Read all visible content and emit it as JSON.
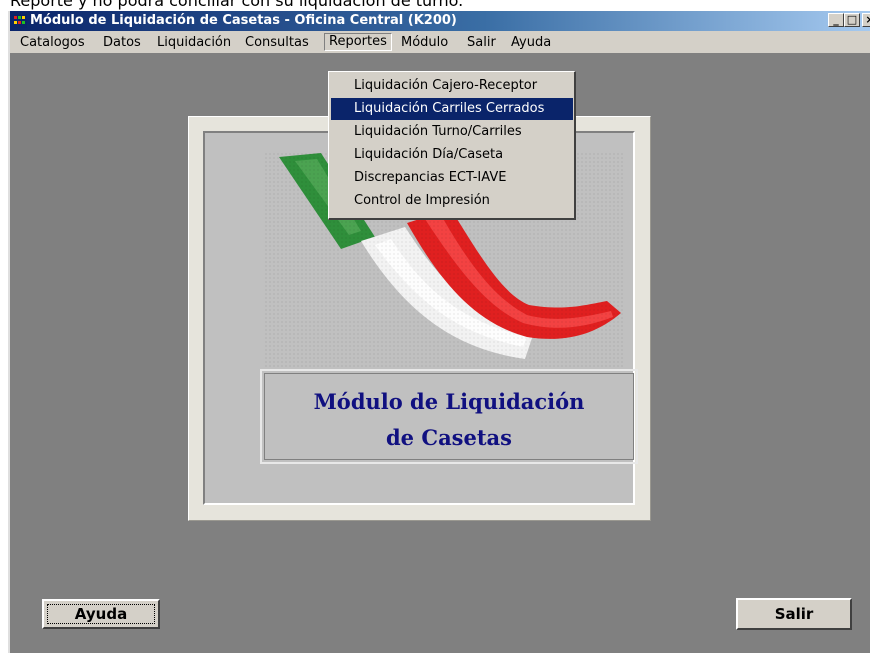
{
  "clipped_caption": "Reporte y no podrá conciliar con su liquidación de turno.",
  "window": {
    "title": "Módulo de Liquidación de Casetas - Oficina Central (K200)",
    "controls": {
      "minimize": "_",
      "maximize": "□",
      "close": "×"
    }
  },
  "menubar": {
    "items": [
      "Catalogos",
      "Datos",
      "Liquidación",
      "Consultas",
      "Reportes",
      "Módulo",
      "Salir",
      "Ayuda"
    ],
    "active": "Reportes"
  },
  "reportes_menu": {
    "items": [
      "Liquidación Cajero-Receptor",
      "Liquidación Carriles Cerrados",
      "Liquidación Turno/Carriles",
      "Liquidación Día/Caseta",
      "Discrepancias ECT-IAVE",
      "Control de Impresión"
    ],
    "highlighted": "Liquidación Carriles Cerrados"
  },
  "splash": {
    "title_line1": "Módulo de Liquidación",
    "title_line2": "de Casetas",
    "logo": "tricolor-waves-logo",
    "logo_colors": [
      "#1f8a2c",
      "#f2f2f2",
      "#e02020"
    ]
  },
  "buttons": {
    "help": "Ayuda",
    "exit": "Salir"
  },
  "colors": {
    "titlebar_start": "#0a246a",
    "menu_highlight": "#0a246a",
    "workspace": "#808080",
    "title_text": "#101080"
  }
}
